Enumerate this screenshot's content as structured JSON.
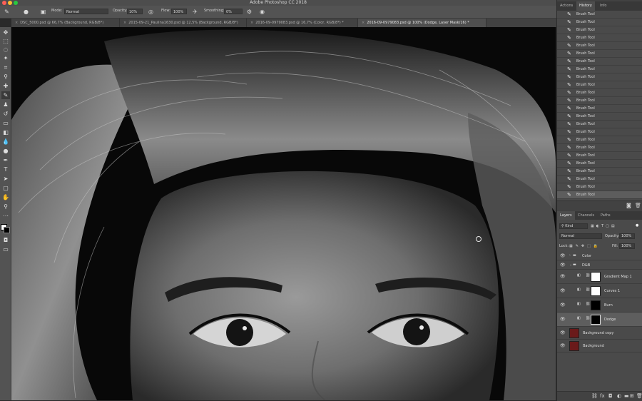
{
  "window": {
    "title": "Adobe Photoshop CC 2018"
  },
  "options_bar": {
    "mode_label": "Mode:",
    "mode_value": "Normal",
    "opacity_label": "Opacity:",
    "opacity_value": "10%",
    "flow_label": "Flow:",
    "flow_value": "100%",
    "smoothing_label": "Smoothing:",
    "smoothing_value": "0%"
  },
  "doc_tabs": [
    {
      "label": "DSC_5000.psd @ 66,7% (Background, RGB/8*)",
      "active": false
    },
    {
      "label": "2015-09-21_Paulina1630.psd @ 12,5% (Background, RGB/8*)",
      "active": false
    },
    {
      "label": "2016-09-0979083.psd @ 16,7% (Color, RGB/8*) *",
      "active": false
    },
    {
      "label": "2016-09-0979083.psd @ 100% (Dodge, Layer Mask/16) *",
      "active": true
    }
  ],
  "panels": {
    "top_tabs": [
      {
        "label": "Actions",
        "active": false
      },
      {
        "label": "History",
        "active": true
      },
      {
        "label": "Info",
        "active": false
      }
    ],
    "history_items": [
      "Brush Tool",
      "Brush Tool",
      "Brush Tool",
      "Brush Tool",
      "Brush Tool",
      "Brush Tool",
      "Brush Tool",
      "Brush Tool",
      "Brush Tool",
      "Brush Tool",
      "Brush Tool",
      "Brush Tool",
      "Brush Tool",
      "Brush Tool",
      "Brush Tool",
      "Brush Tool",
      "Brush Tool",
      "Brush Tool",
      "Brush Tool",
      "Brush Tool",
      "Brush Tool",
      "Brush Tool",
      "Brush Tool",
      "Brush Tool"
    ],
    "history_active_index": 23,
    "layer_tabs": [
      {
        "label": "Layers",
        "active": true
      },
      {
        "label": "Channels",
        "active": false
      },
      {
        "label": "Paths",
        "active": false
      }
    ],
    "filter_kind": "Kind",
    "blend_mode": "Normal",
    "opacity_label": "Opacity:",
    "opacity_value": "100%",
    "lock_label": "Lock:",
    "fill_label": "Fill:",
    "fill_value": "100%",
    "layers": [
      {
        "name": "Color",
        "kind": "group",
        "active": false
      },
      {
        "name": "D&B",
        "kind": "group-open",
        "active": false
      },
      {
        "name": "Gradient Map 1",
        "kind": "adjustment",
        "mask_color": "#ffffff",
        "active": false
      },
      {
        "name": "Curves 1",
        "kind": "adjustment",
        "mask_color": "#ffffff",
        "active": false
      },
      {
        "name": "Burn",
        "kind": "adjustment",
        "mask_color": "#000000",
        "active": false
      },
      {
        "name": "Dodge",
        "kind": "adjustment",
        "mask_color": "#000000",
        "active": true
      },
      {
        "name": "Background copy",
        "kind": "pixel",
        "active": false
      },
      {
        "name": "Background",
        "kind": "pixel",
        "active": false
      }
    ]
  },
  "colors": {
    "accent_selected": "#5e5e5e",
    "panel_bg": "#4a4a4a",
    "chrome": "#535353"
  }
}
